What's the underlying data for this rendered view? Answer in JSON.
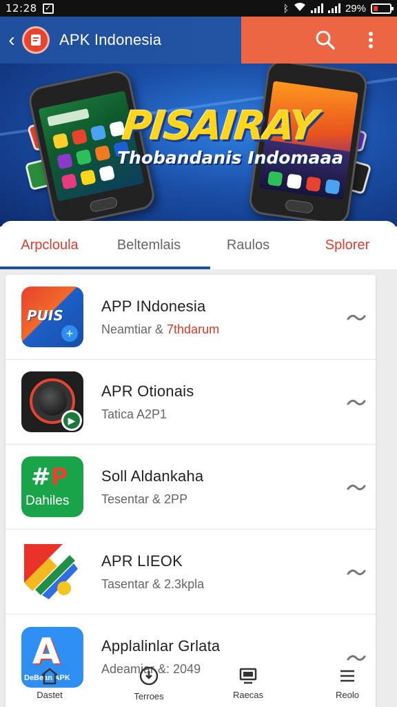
{
  "status_bar": {
    "time": "12:28",
    "battery": "29%",
    "icons": [
      "check-notification-icon",
      "bluetooth-icon",
      "wifi-icon",
      "signal-icon",
      "battery-icon"
    ]
  },
  "app_bar": {
    "title": "APK Indonesia",
    "back_icon": "chevron-left-icon",
    "logo_icon": "app-logo-icon",
    "actions": [
      "search-icon",
      "more-vertical-icon"
    ],
    "colors": {
      "primary": "#1f4f9d",
      "accent": "#ec6644"
    }
  },
  "banner": {
    "headline": "PISAIRAY",
    "tagline": "Thobandanis Indomaaa"
  },
  "tabs": [
    {
      "label": "Arpcloula",
      "active": true
    },
    {
      "label": "Beltemlais",
      "active": false
    },
    {
      "label": "Raulos",
      "active": false
    },
    {
      "label": "Splorer",
      "active": false
    }
  ],
  "apps": [
    {
      "name": "APP INdonesia",
      "meta_prefix": "Neamtiar & ",
      "meta_highlight": "7thdarum",
      "icon_text": "PUIS"
    },
    {
      "name": "APR Otionais",
      "meta_prefix": "Tatica A2P1",
      "meta_highlight": "",
      "icon_text": ""
    },
    {
      "name": "Soll Aldankaha",
      "meta_prefix": "Tesentar & 2PP",
      "meta_highlight": "",
      "icon_text": "Dahiles"
    },
    {
      "name": "APR LIEOK",
      "meta_prefix": "Tasentar &  2.3kpla",
      "meta_highlight": "",
      "icon_text": ""
    },
    {
      "name": "Applalinlar Grlata",
      "meta_prefix": "Adeamiar &: 2049",
      "meta_highlight": "",
      "icon_text": "DeBean APK"
    }
  ],
  "bottom_nav": [
    {
      "label": "Dastet",
      "icon": "home-icon"
    },
    {
      "label": "Terroes",
      "icon": "download-clock-icon"
    },
    {
      "label": "Raecas",
      "icon": "screen-icon"
    },
    {
      "label": "Reolo",
      "icon": "menu-list-icon"
    }
  ]
}
